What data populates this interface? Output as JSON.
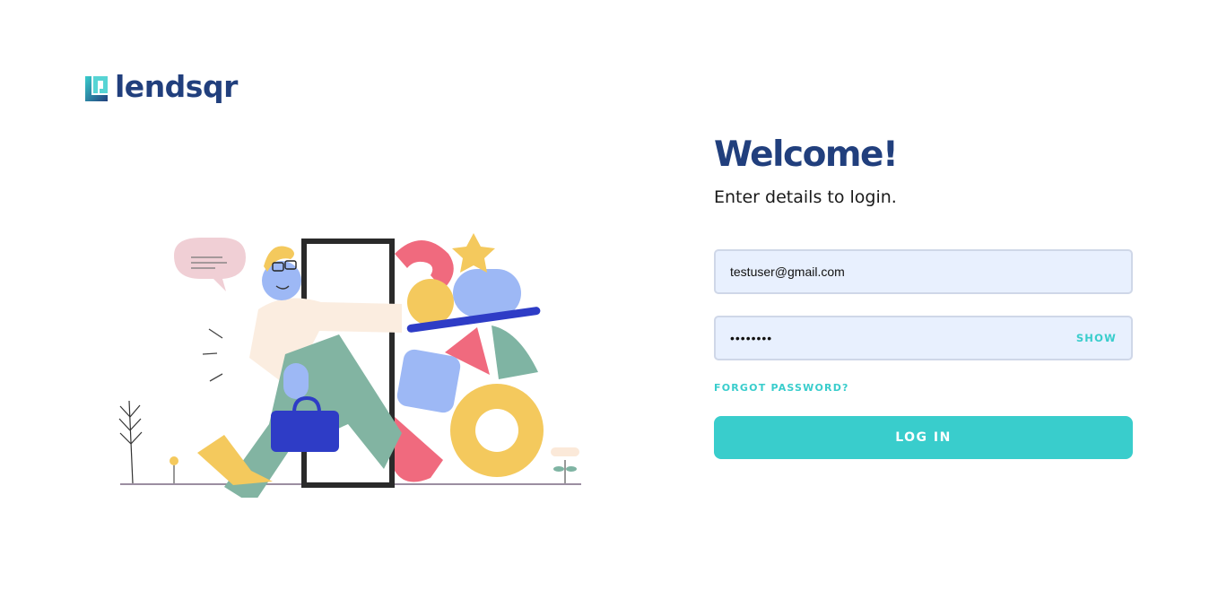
{
  "brand": {
    "name": "lendsqr",
    "colors": {
      "primary": "#213F7D",
      "accent": "#39CDCC",
      "field_bg": "#E8F0FE"
    }
  },
  "illustration": {
    "icon": "person-walking-through-door-illustration"
  },
  "login": {
    "title": "Welcome!",
    "subtitle": "Enter details to login.",
    "email_value": "testuser@gmail.com",
    "password_value": "••••••••",
    "show_label": "SHOW",
    "forgot_label": "FORGOT PASSWORD?",
    "submit_label": "LOG IN"
  }
}
